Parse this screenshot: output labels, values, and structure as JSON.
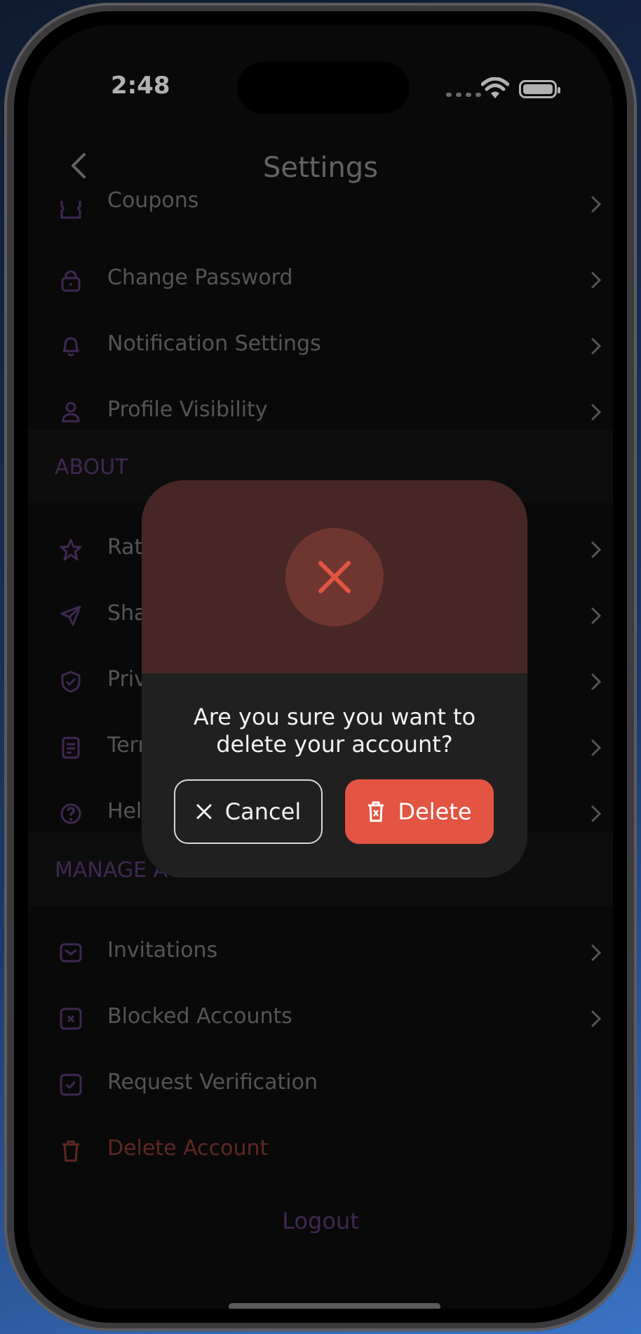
{
  "status_bar": {
    "time": "2:48"
  },
  "header": {
    "title": "Settings"
  },
  "rows_top": [
    {
      "label": "Coupons",
      "icon": "ticket-icon"
    },
    {
      "label": "Change Password",
      "icon": "lock-icon"
    },
    {
      "label": "Notification Settings",
      "icon": "bell-icon"
    },
    {
      "label": "Profile Visibility",
      "icon": "user-icon"
    }
  ],
  "section_about": {
    "label": "ABOUT"
  },
  "rows_about": [
    {
      "label": "Rat",
      "icon": "star-icon"
    },
    {
      "label": "Sha",
      "icon": "send-icon"
    },
    {
      "label": "Priv",
      "icon": "shield-check-icon"
    },
    {
      "label": "Terr",
      "icon": "document-icon"
    },
    {
      "label": "Hel",
      "icon": "help-circle-icon"
    }
  ],
  "section_manage": {
    "label": "MANAGE ACCOUNT"
  },
  "rows_manage": [
    {
      "label": "Invitations",
      "icon": "mail-icon"
    },
    {
      "label": "Blocked Accounts",
      "icon": "blocked-icon"
    },
    {
      "label": "Request Verification",
      "icon": "check-square-icon"
    },
    {
      "label": "Delete Account",
      "icon": "trash-icon"
    }
  ],
  "logout": {
    "label": "Logout"
  },
  "dialog": {
    "message_line1": "Are you sure you want to",
    "message_line2": "delete your account?",
    "cancel_label": "Cancel",
    "delete_label": "Delete"
  },
  "colors": {
    "accent_purple": "#5b3a78",
    "danger_red": "#e35443",
    "dialog_top": "#472726"
  }
}
